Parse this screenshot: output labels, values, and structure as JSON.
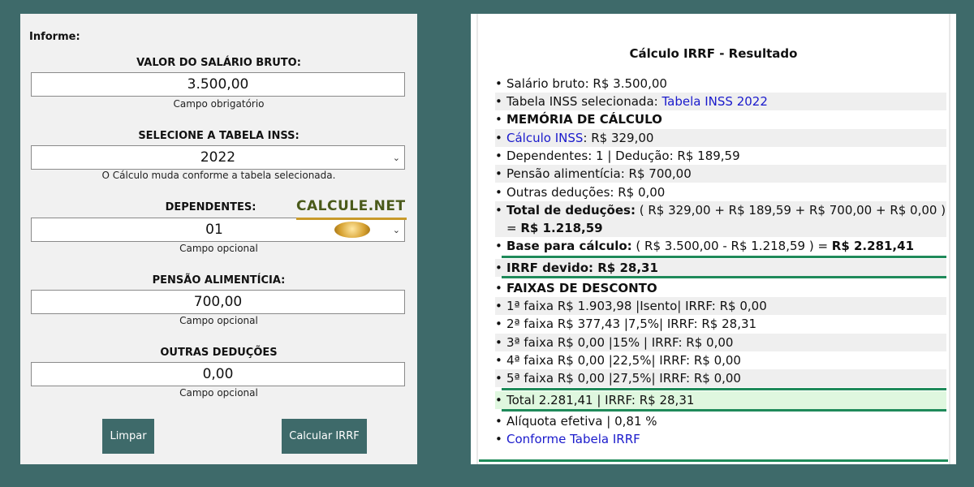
{
  "form": {
    "informe": "Informe:",
    "salario": {
      "label": "VALOR DO SALÁRIO BRUTO:",
      "value": "3.500,00",
      "hint": "Campo obrigatório"
    },
    "tabela": {
      "label": "SELECIONE A TABELA INSS:",
      "value": "2022",
      "hint": "O Cálculo muda conforme a tabela selecionada."
    },
    "dependentes": {
      "label": "DEPENDENTES:",
      "value": "01",
      "hint": "Campo opcional"
    },
    "pensao": {
      "label": "PENSÃO ALIMENTÍCIA:",
      "value": "700,00",
      "hint": "Campo opcional"
    },
    "outras": {
      "label": "OUTRAS DEDUÇÕES",
      "value": "0,00",
      "hint": "Campo opcional"
    },
    "btn_limpar": "Limpar",
    "btn_calcular": "Calcular IRRF",
    "chevron": "⌄",
    "logo_text": "CALCULE.NET"
  },
  "result": {
    "title": "Cálculo IRRF - Resultado",
    "salario_bruto": "Salário bruto: R$ 3.500,00",
    "tabela_inss_prefix": "Tabela INSS selecionada: ",
    "tabela_inss_link": "Tabela INSS 2022",
    "memoria": "MEMÓRIA DE CÁLCULO",
    "calculo_inss_link": "Cálculo INSS",
    "calculo_inss_value": ": R$ 329,00",
    "dependentes": "Dependentes: 1 | Dedução: R$ 189,59",
    "pensao": "Pensão alimentícia: R$ 700,00",
    "outras": "Outras deduções: R$ 0,00",
    "total_ded_label": "Total de deduções:",
    "total_ded_expr": " ( R$ 329,00 + R$ 189,59 + R$ 700,00 + R$ 0,00 ) = ",
    "total_ded_value": "R$ 1.218,59",
    "base_label": "Base para cálculo:",
    "base_expr": " ( R$ 3.500,00 - R$ 1.218,59 ) = ",
    "base_value": "R$ 2.281,41",
    "irrf_devido": "IRRF devido: R$ 28,31",
    "faixas_title": "FAIXAS DE DESCONTO",
    "faixas": [
      "1ª faixa R$ 1.903,98 |Isento| IRRF: R$ 0,00",
      "2ª faixa R$ 377,43 |7,5%| IRRF: R$ 28,31",
      "3ª faixa R$ 0,00 |15% | IRRF: R$ 0,00",
      "4ª faixa R$ 0,00 |22,5%| IRRF: R$ 0,00",
      "5ª faixa R$ 0,00 |27,5%| IRRF: R$ 0,00"
    ],
    "total": "Total 2.281,41 | IRRF: R$ 28,31",
    "aliquota": "Alíquota efetiva | 0,81 %",
    "conforme_link": "Conforme Tabela IRRF"
  },
  "colors": {
    "background": "#3e6a6a",
    "button": "#3e6a6a",
    "link": "#1a1acc",
    "accent_line": "#1f8a5a",
    "total_highlight": "#dff7df"
  }
}
